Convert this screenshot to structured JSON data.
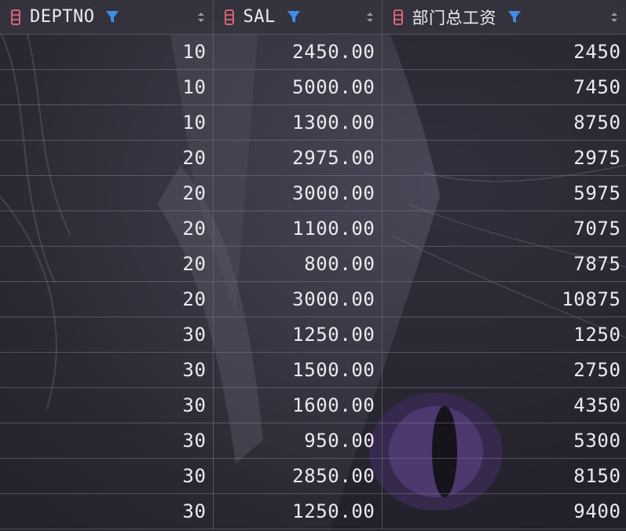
{
  "colors": {
    "column_icon": "#e86a78",
    "filter_icon": "#3d8ee8",
    "text": "#ecebf0",
    "grid_line": "#55545f"
  },
  "header": {
    "columns": [
      {
        "name": "DEPTNO",
        "icon": "column-icon",
        "filter": "filter-icon",
        "sort": "sort-icon"
      },
      {
        "name": "SAL",
        "icon": "column-icon",
        "filter": "filter-icon",
        "sort": "sort-icon"
      },
      {
        "name": "部门总工资",
        "icon": "column-icon",
        "filter": "filter-icon",
        "sort": "sort-icon"
      }
    ]
  },
  "rows": [
    [
      "10",
      "2450.00",
      "2450"
    ],
    [
      "10",
      "5000.00",
      "7450"
    ],
    [
      "10",
      "1300.00",
      "8750"
    ],
    [
      "20",
      "2975.00",
      "2975"
    ],
    [
      "20",
      "3000.00",
      "5975"
    ],
    [
      "20",
      "1100.00",
      "7075"
    ],
    [
      "20",
      "800.00",
      "7875"
    ],
    [
      "20",
      "3000.00",
      "10875"
    ],
    [
      "30",
      "1250.00",
      "1250"
    ],
    [
      "30",
      "1500.00",
      "2750"
    ],
    [
      "30",
      "1600.00",
      "4350"
    ],
    [
      "30",
      "950.00",
      "5300"
    ],
    [
      "30",
      "2850.00",
      "8150"
    ],
    [
      "30",
      "1250.00",
      "9400"
    ]
  ]
}
